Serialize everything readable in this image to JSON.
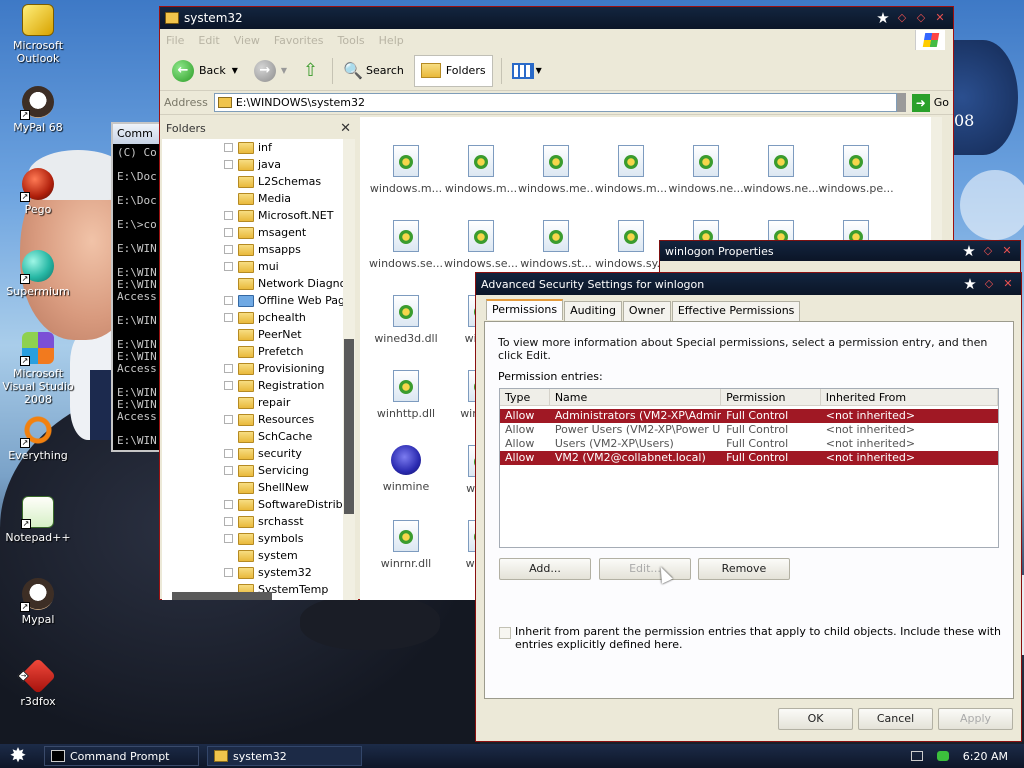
{
  "desktop": {
    "icons": [
      {
        "label": "Microsoft Outlook",
        "icon": "outlook-icon"
      },
      {
        "label": "MyPal 68",
        "icon": "mypal-icon"
      },
      {
        "label": "Pego",
        "icon": "pego-icon"
      },
      {
        "label": "Supermium",
        "icon": "supermium-icon"
      },
      {
        "label": "Microsoft Visual Studio 2008",
        "icon": "visual-studio-icon"
      },
      {
        "label": "Everything",
        "icon": "everything-icon"
      },
      {
        "label": "Notepad++",
        "icon": "notepadpp-icon"
      },
      {
        "label": "Mypal",
        "icon": "mypal-icon"
      },
      {
        "label": "r3dfox",
        "icon": "r3dfox-icon"
      }
    ],
    "wallpaper_text": "08"
  },
  "cmd": {
    "title": "Comm",
    "lines": [
      "(C) Co",
      "",
      "E:\\Doc",
      "",
      "E:\\Doc",
      "",
      "E:\\>co",
      "",
      "E:\\WIN",
      "",
      "E:\\WIN",
      "E:\\WIN",
      "Access",
      "",
      "E:\\WIN",
      "",
      "E:\\WIN",
      "E:\\WIN",
      "Access",
      "",
      "E:\\WIN",
      "E:\\WIN",
      "Access",
      "",
      "E:\\WIN"
    ]
  },
  "explorer": {
    "title": "system32",
    "menu": [
      "File",
      "Edit",
      "View",
      "Favorites",
      "Tools",
      "Help"
    ],
    "toolbar": {
      "back": "Back",
      "search": "Search",
      "folders": "Folders"
    },
    "address": {
      "label": "Address",
      "path": "E:\\WINDOWS\\system32",
      "go": "Go"
    },
    "folders_pane": {
      "title": "Folders",
      "items": [
        {
          "label": "inf",
          "expand": true
        },
        {
          "label": "java",
          "expand": true
        },
        {
          "label": "L2Schemas",
          "expand": false
        },
        {
          "label": "Media",
          "expand": false
        },
        {
          "label": "Microsoft.NET",
          "expand": true
        },
        {
          "label": "msagent",
          "expand": true
        },
        {
          "label": "msapps",
          "expand": true
        },
        {
          "label": "mui",
          "expand": true
        },
        {
          "label": "Network Diagnostic",
          "expand": false
        },
        {
          "label": "Offline Web Pages",
          "expand": true,
          "web": true
        },
        {
          "label": "pchealth",
          "expand": true
        },
        {
          "label": "PeerNet",
          "expand": false
        },
        {
          "label": "Prefetch",
          "expand": false
        },
        {
          "label": "Provisioning",
          "expand": true
        },
        {
          "label": "Registration",
          "expand": true
        },
        {
          "label": "repair",
          "expand": false
        },
        {
          "label": "Resources",
          "expand": true
        },
        {
          "label": "SchCache",
          "expand": false
        },
        {
          "label": "security",
          "expand": true
        },
        {
          "label": "Servicing",
          "expand": true
        },
        {
          "label": "ShellNew",
          "expand": false
        },
        {
          "label": "SoftwareDistributio",
          "expand": true
        },
        {
          "label": "srchasst",
          "expand": true
        },
        {
          "label": "symbols",
          "expand": true
        },
        {
          "label": "system",
          "expand": false
        },
        {
          "label": "system32",
          "expand": true
        },
        {
          "label": "SystemTemp",
          "expand": false
        }
      ]
    },
    "files": [
      {
        "label": "windows.m..."
      },
      {
        "label": "windows.m..."
      },
      {
        "label": "windows.me..."
      },
      {
        "label": "windows.m..."
      },
      {
        "label": "windows.ne..."
      },
      {
        "label": "windows.ne..."
      },
      {
        "label": "windows.pe..."
      },
      {
        "label": "windows.se..."
      },
      {
        "label": "windows.se..."
      },
      {
        "label": "windows.st..."
      },
      {
        "label": "windows.sy..."
      },
      {
        "label": ""
      },
      {
        "label": ""
      },
      {
        "label": ""
      },
      {
        "label": "wined3d.dll"
      },
      {
        "label": "wined"
      },
      {
        "label": "winhttp.dll"
      },
      {
        "label": "winhttp"
      },
      {
        "label": "winmine"
      },
      {
        "label": "winm"
      },
      {
        "label": "winrnr.dll"
      },
      {
        "label": "winsc"
      }
    ]
  },
  "props": {
    "title": "winlogon Properties"
  },
  "advanced": {
    "title": "Advanced Security Settings for winlogon",
    "tabs": [
      "Permissions",
      "Auditing",
      "Owner",
      "Effective Permissions"
    ],
    "info": "To view more information about Special permissions, select a permission entry, and then click Edit.",
    "entries_label": "Permission entries:",
    "columns": [
      "Type",
      "Name",
      "Permission",
      "Inherited From"
    ],
    "rows": [
      {
        "type": "Allow",
        "name": "Administrators (VM2-XP\\Adminis...",
        "permission": "Full Control",
        "inherited": "<not inherited>",
        "selected": true
      },
      {
        "type": "Allow",
        "name": "Power Users (VM2-XP\\Power U...",
        "permission": "Full Control",
        "inherited": "<not inherited>",
        "selected": false
      },
      {
        "type": "Allow",
        "name": "Users (VM2-XP\\Users)",
        "permission": "Full Control",
        "inherited": "<not inherited>",
        "selected": false
      },
      {
        "type": "Allow",
        "name": "VM2 (VM2@collabnet.local)",
        "permission": "Full Control",
        "inherited": "<not inherited>",
        "selected": true
      }
    ],
    "buttons": {
      "add": "Add...",
      "edit": "Edit...",
      "remove": "Remove",
      "ok": "OK",
      "cancel": "Cancel",
      "apply": "Apply"
    },
    "inherit_text": "Inherit from parent the permission entries that apply to child objects. Include these with entries explicitly defined here."
  },
  "taskbar": {
    "tasks": [
      {
        "label": "Command Prompt"
      },
      {
        "label": "system32"
      }
    ],
    "clock": "6:20 AM"
  },
  "colors": {
    "selection": "#a01824",
    "title_bar": "#13253f",
    "accent_red": "#9c1010"
  }
}
